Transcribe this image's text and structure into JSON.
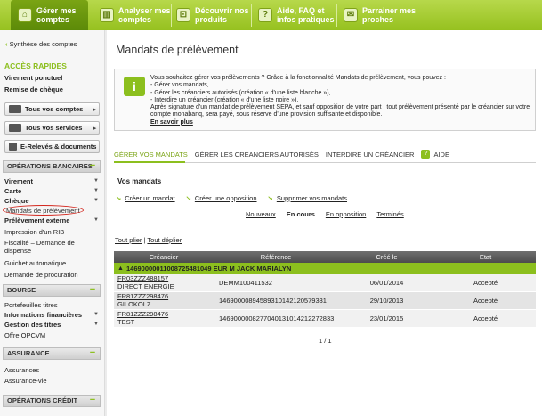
{
  "nav": {
    "tabs": [
      {
        "label": "Gérer mes comptes",
        "icon": "home-icon",
        "active": true
      },
      {
        "label": "Analyser mes comptes",
        "icon": "chart-icon",
        "active": false
      },
      {
        "label": "Découvrir nos produits",
        "icon": "cart-icon",
        "active": false
      },
      {
        "label": "Aide, FAQ et infos pratiques",
        "icon": "help-icon",
        "active": false
      },
      {
        "label": "Parrainer mes proches",
        "icon": "gift-icon",
        "active": false
      }
    ]
  },
  "sidebar": {
    "synthese": "Synthèse des comptes",
    "acces_rapides": "ACCÈS RAPIDES",
    "quick": [
      "Virement ponctuel",
      "Remise de chèque"
    ],
    "buttons": [
      "Tous vos comptes",
      "Tous vos services",
      "E-Relevés & documents"
    ],
    "operations_title": "OPÉRATIONS BANCAIRES",
    "operations": [
      "Virement",
      "Carte",
      "Chèque",
      "Mandats de prélèvement",
      "Prélèvement externe",
      "Impression d'un RIB",
      "Fiscalité – Demande de dispense",
      "Guichet automatique",
      "Demande de procuration"
    ],
    "bourse_title": "BOURSE",
    "bourse": [
      "Portefeuilles titres",
      "Informations financières",
      "Gestion des titres",
      "Offre OPCVM"
    ],
    "assurance_title": "ASSURANCE",
    "assurance": [
      "Assurances",
      "Assurance-vie"
    ],
    "credit_title": "OPÉRATIONS CRÉDIT"
  },
  "main": {
    "title": "Mandats de prélèvement",
    "info": {
      "intro": "Vous souhaitez gérer vos prélèvements ? Grâce à la fonctionnalité Mandats de prélèvement, vous pouvez :",
      "l1": "- Gérer vos mandats,",
      "l2": "- Gérer les créanciers autorisés (création « d'une liste blanche »),",
      "l3": "- Interdire un créancier (création « d'une liste noire »).",
      "l4": "Après signature d'un mandat de prélèvement SEPA, et sauf opposition de votre part , tout prélèvement présenté par le créancier sur votre compte monabanq, sera payé, sous réserve d'une provision suffisante et disponible.",
      "more": "En savoir plus"
    },
    "subtabs": [
      "GÉRER VOS MANDATS",
      "GÉRER LES CREANCIERS AUTORISÉS",
      "INTERDIRE UN CRÉANCIER",
      "AIDE"
    ],
    "section": "Vos mandats",
    "actions": [
      "Créer un mandat",
      "Créer une opposition",
      "Supprimer vos mandats"
    ],
    "filters": [
      "Nouveaux",
      "En cours",
      "En opposition",
      "Terminés"
    ],
    "toggle_open": "Tout plier",
    "toggle_sep": " | ",
    "toggle_close": "Tout déplier",
    "table": {
      "headers": [
        "Créancier",
        "Référence",
        "Créé le",
        "Etat"
      ],
      "group": "146900000110087254810​49 EUR M JACK MARIALYN",
      "rows": [
        {
          "code": "FR03ZZZ488157",
          "name": "DIRECT ENERGIE",
          "ref": "DEMM100411532",
          "date": "06/01/2014",
          "etat": "Accepté"
        },
        {
          "code": "FR81ZZZ298476",
          "name": "GILOKOLZ",
          "ref": "1469000089458931014212057933​1",
          "date": "29/10/2013",
          "etat": "Accepté"
        },
        {
          "code": "FR81ZZZ298476",
          "name": "TEST",
          "ref": "146900000827704013101421227283​3",
          "date": "23/01/2015",
          "etat": "Accepté"
        }
      ]
    },
    "pager": "1 / 1"
  },
  "colors": {
    "brand_green": "#8cbf1e",
    "highlight_red": "#d3261d"
  }
}
